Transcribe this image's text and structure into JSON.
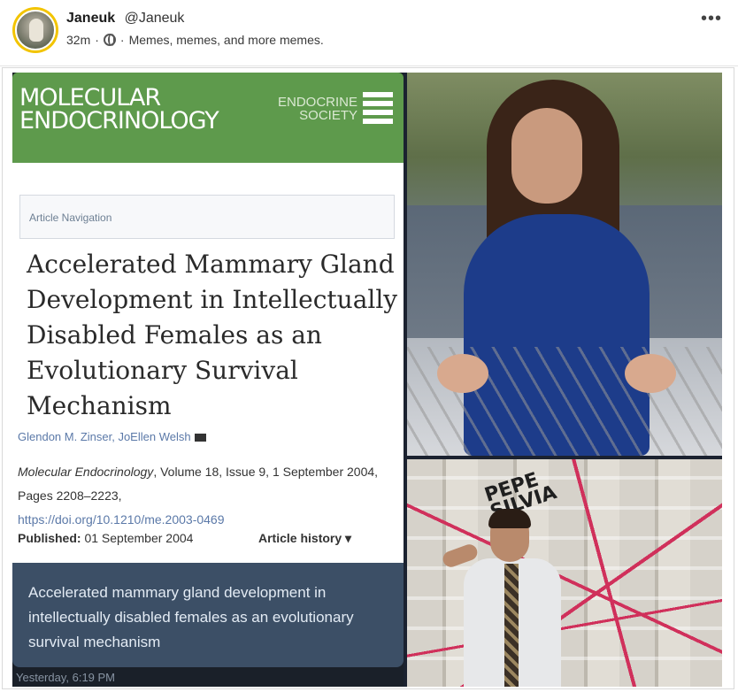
{
  "post": {
    "display_name": "Janeuk",
    "handle": "@Janeuk",
    "time": "32m",
    "separator": "·",
    "group": "Memes, memes, and more memes.",
    "more_label": "•••"
  },
  "meme": {
    "journal": {
      "title": "MOLECULAR\nENDOCRINOLOGY",
      "society": "ENDOCRINE\nSOCIETY"
    },
    "article": {
      "nav_label": "Article Navigation",
      "title": "Accelerated Mammary Gland Development in Intellectually Disabled Females as an Evolutionary Survival Mechanism",
      "authors": "Glendon M. Zinser, JoEllen Welsh",
      "journal_name": "Molecular Endocrinology",
      "citation_rest": ", Volume 18, Issue 9, 1 September 2004, Pages 2208–2223,",
      "doi": "https://doi.org/10.1210/me.2003-0469",
      "published_label": "Published:",
      "published_date": "01 September 2004",
      "history_label": "Article history ▾"
    },
    "preview_text": "Accelerated mammary gland development in intellectually disabled females as an evolutionary survival mechanism",
    "timestamp": "Yesterday, 6:19 PM",
    "graffiti": "PEPE\nSILVIA"
  }
}
